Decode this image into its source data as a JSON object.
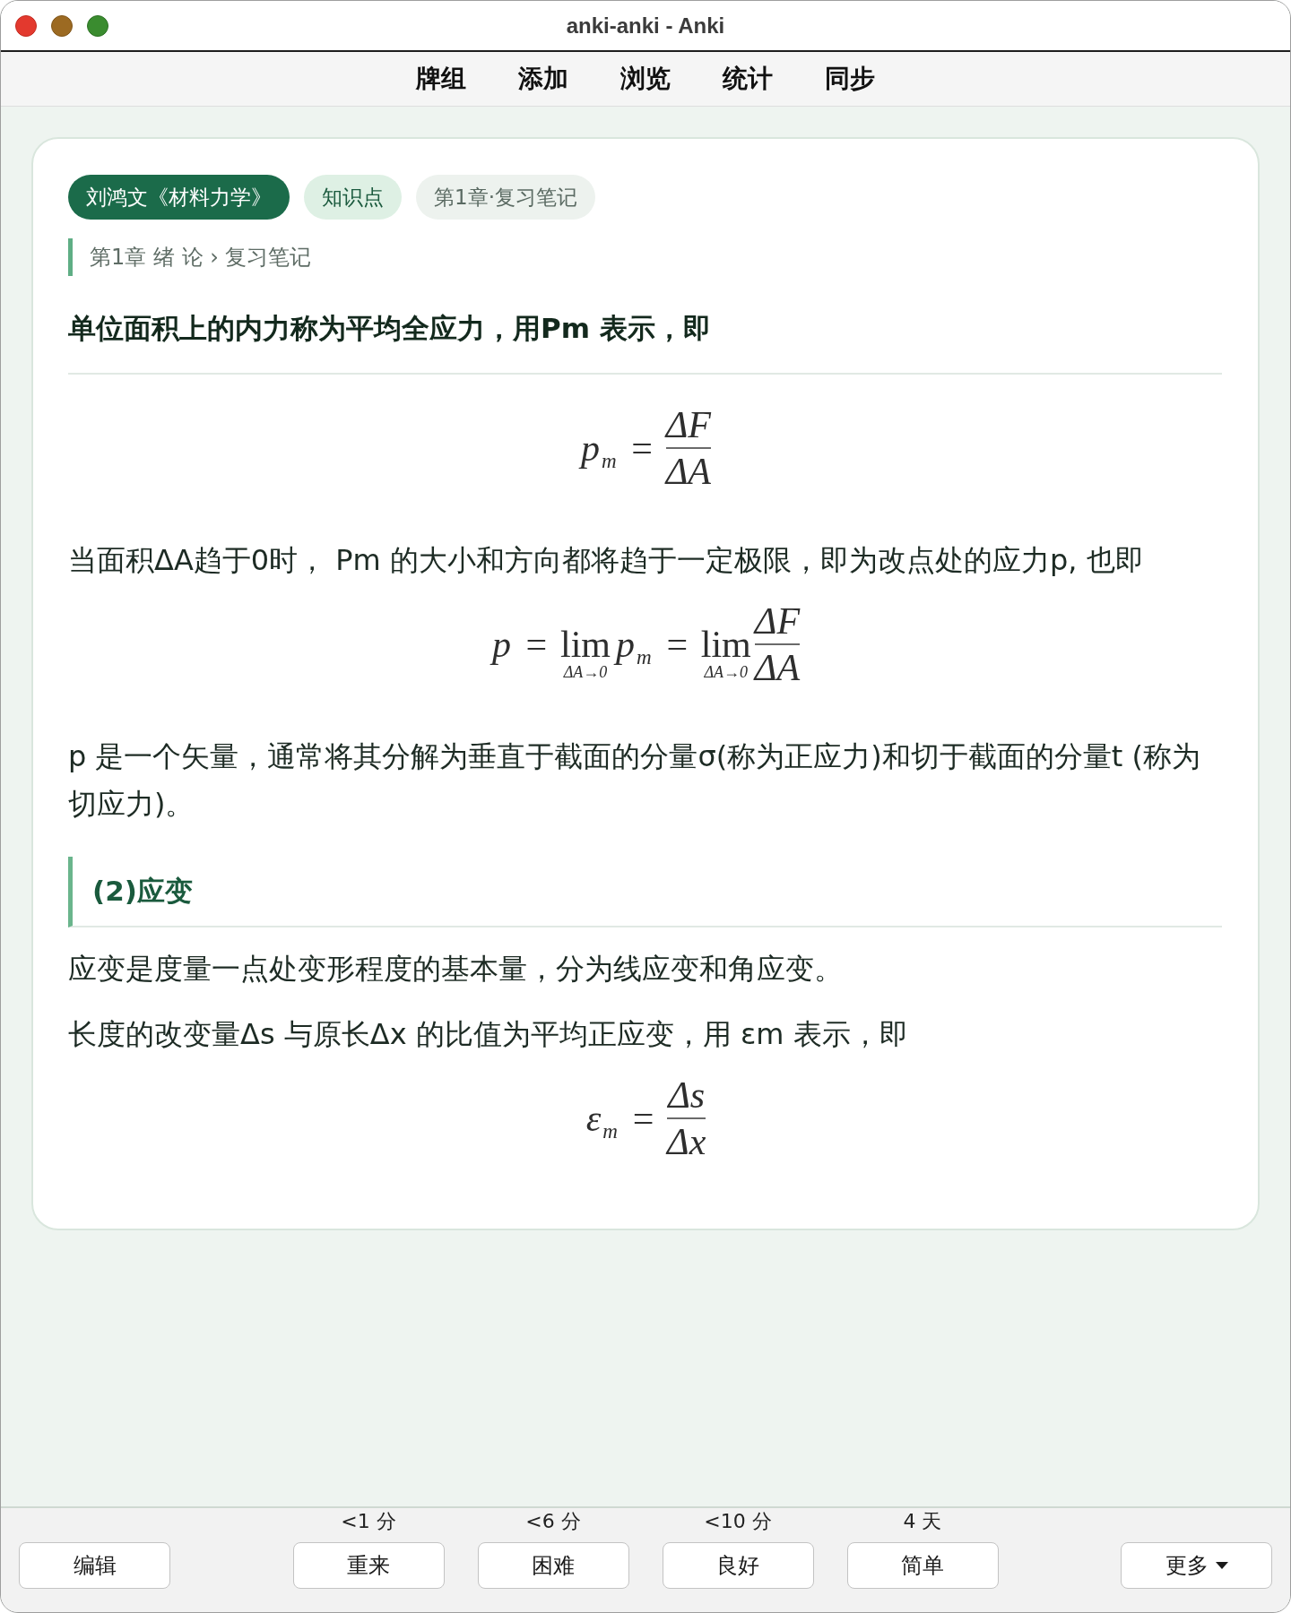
{
  "window": {
    "title": "anki-anki - Anki"
  },
  "toolbar": [
    "牌组",
    "添加",
    "浏览",
    "统计",
    "同步"
  ],
  "card": {
    "tags": [
      {
        "kind": "filled",
        "label": "刘鸿文《材料力学》"
      },
      {
        "kind": "tint",
        "label": "知识点"
      },
      {
        "kind": "plain",
        "label": "第1章·复习笔记"
      }
    ],
    "breadcrumb": "第1章 绪 论 › 复习笔记",
    "blocks": [
      {
        "kind": "lead",
        "text": "单位面积上的内力称为平均全应力，用Pm 表示，即"
      },
      {
        "kind": "formula",
        "terms": [
          {
            "kind": "var",
            "text": "p",
            "sub": "m"
          },
          {
            "kind": "op",
            "text": "="
          },
          {
            "kind": "frac",
            "num": "ΔF",
            "den": "ΔA"
          }
        ]
      },
      {
        "kind": "paragraph",
        "text": "当面积ΔA趋于0时， Pm 的大小和方向都将趋于一定极限，即为改点处的应力p, 也即"
      },
      {
        "kind": "formula",
        "terms": [
          {
            "kind": "var",
            "text": "p"
          },
          {
            "kind": "op",
            "text": "="
          },
          {
            "kind": "lim",
            "text": "lim",
            "under": "ΔA→0"
          },
          {
            "kind": "var",
            "text": "p",
            "sub": "m"
          },
          {
            "kind": "op",
            "text": "="
          },
          {
            "kind": "lim",
            "text": "lim",
            "under": "ΔA→0"
          },
          {
            "kind": "frac",
            "num": "ΔF",
            "den": "ΔA"
          }
        ]
      },
      {
        "kind": "paragraph",
        "text": "p 是一个矢量，通常将其分解为垂直于截面的分量σ(称为正应力)和切于截面的分量t (称为切应力)。"
      },
      {
        "kind": "section",
        "text": "(2)应变"
      },
      {
        "kind": "paragraph",
        "text": "应变是度量一点处变形程度的基本量，分为线应变和角应变。"
      },
      {
        "kind": "paragraph",
        "text": "长度的改变量Δs 与原长Δx 的比值为平均正应变，用 εm 表示，即"
      },
      {
        "kind": "formula",
        "terms": [
          {
            "kind": "var",
            "text": "ε",
            "sub": "m"
          },
          {
            "kind": "op",
            "text": "="
          },
          {
            "kind": "frac",
            "num": "Δs",
            "den": "Δx"
          }
        ]
      }
    ]
  },
  "answer_bar": {
    "edit_button": "编辑",
    "answers": [
      {
        "interval": "<1 分",
        "label": "重来"
      },
      {
        "interval": "<6 分",
        "label": "困难"
      },
      {
        "interval": "<10 分",
        "label": "良好"
      },
      {
        "interval": "4 天",
        "label": "简单"
      }
    ],
    "more_button": "更多"
  }
}
